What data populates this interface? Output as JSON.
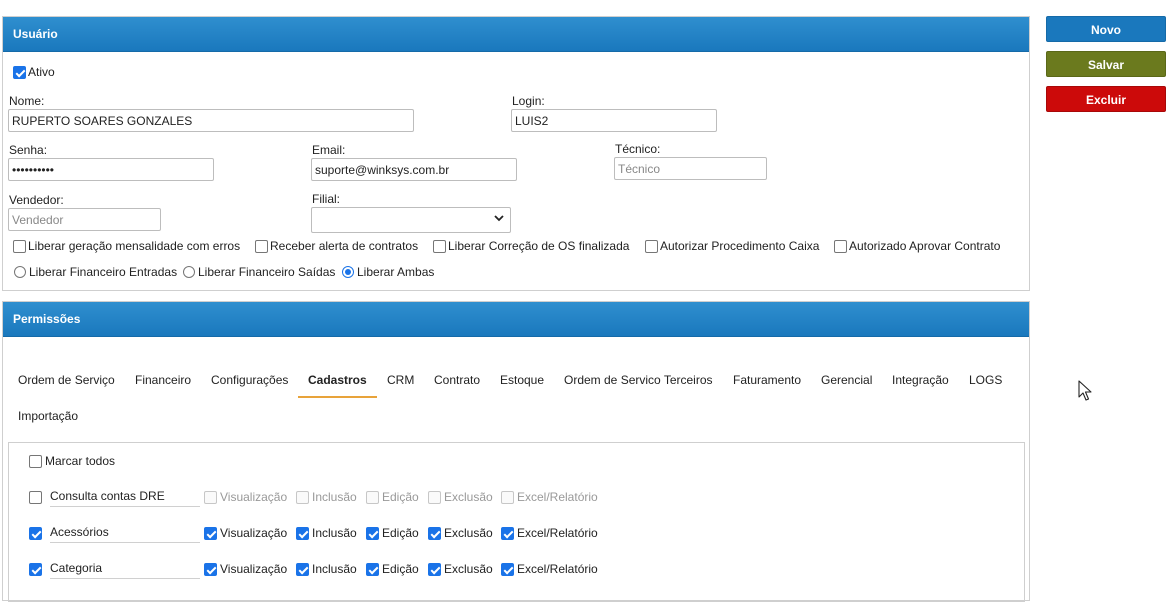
{
  "usuario": {
    "title": "Usuário",
    "ativo_label": "Ativo",
    "nome": {
      "label": "Nome:",
      "value": "RUPERTO SOARES GONZALES"
    },
    "login": {
      "label": "Login:",
      "value": "LUIS2"
    },
    "senha": {
      "label": "Senha:",
      "value": "••••••••••"
    },
    "email": {
      "label": "Email:",
      "value": "suporte@winksys.com.br"
    },
    "tecnico": {
      "label": "Técnico:",
      "placeholder": "Técnico"
    },
    "vendedor": {
      "label": "Vendedor:",
      "placeholder": "Vendedor"
    },
    "filial": {
      "label": "Filial:",
      "value": ""
    },
    "checkboxes": [
      "Liberar geração mensalidade com erros",
      "Receber alerta de contratos",
      "Liberar Correção de OS finalizada",
      "Autorizar Procedimento Caixa",
      "Autorizado Aprovar Contrato"
    ],
    "radios": [
      "Liberar Financeiro Entradas",
      "Liberar Financeiro Saídas",
      "Liberar Ambas"
    ],
    "radio_selected": "Liberar Ambas"
  },
  "permissoes": {
    "title": "Permissões",
    "tabs": [
      "Ordem de Serviço",
      "Financeiro",
      "Configurações",
      "Cadastros",
      "CRM",
      "Contrato",
      "Estoque",
      "Ordem de Servico Terceiros",
      "Faturamento",
      "Gerencial",
      "Integração",
      "LOGS",
      "Importação"
    ],
    "active_tab": "Cadastros",
    "marcar_todos": "Marcar todos",
    "columns": [
      "Visualização",
      "Inclusão",
      "Edição",
      "Exclusão",
      "Excel/Relatório"
    ],
    "rows": [
      {
        "name": "Consulta contas DRE",
        "checked": false
      },
      {
        "name": "Acessórios",
        "checked": true
      },
      {
        "name": "Categoria",
        "checked": true
      }
    ]
  },
  "actions": {
    "novo": "Novo",
    "salvar": "Salvar",
    "excluir": "Excluir",
    "colors": {
      "novo": "#1a78bd",
      "salvar": "#6b7a1e",
      "excluir": "#cc0a0a"
    }
  }
}
